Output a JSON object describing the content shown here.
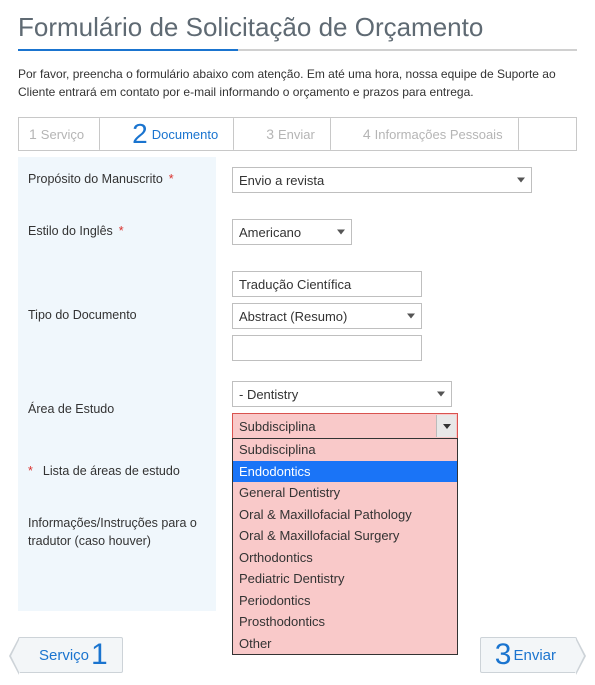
{
  "title": "Formulário de Solicitação de Orçamento",
  "intro": "Por favor, preencha o formulário abaixo com atenção. Em até uma hora, nossa equipe de Suporte ao Cliente entrará em contato por e-mail informando o orçamento e prazos para entrega.",
  "steps": [
    {
      "num": "1",
      "label": "Serviço"
    },
    {
      "num": "2",
      "label": "Documento"
    },
    {
      "num": "3",
      "label": "Enviar"
    },
    {
      "num": "4",
      "label": "Informações Pessoais"
    }
  ],
  "activeStep": 1,
  "fields": {
    "purpose": {
      "label": "Propósito do Manuscrito",
      "required": true,
      "value": "Envio a revista"
    },
    "english": {
      "label": "Estilo do Inglês",
      "required": true,
      "value": "Americano"
    },
    "doctype": {
      "label": "Tipo do Documento",
      "text1": "Tradução Científica",
      "select": "Abstract (Resumo)",
      "text2": ""
    },
    "area": {
      "label": "Área de Estudo",
      "required": true,
      "parent": "- Dentistry",
      "subPlaceholder": "Subdisciplina",
      "options": [
        "Subdisciplina",
        "Endodontics",
        "General Dentistry",
        "Oral & Maxillofacial Pathology",
        "Oral & Maxillofacial Surgery",
        "Orthodontics",
        "Pediatric Dentistry",
        "Periodontics",
        "Prosthodontics",
        "Other"
      ],
      "highlighted": "Endodontics"
    },
    "list": {
      "label": "Lista de áreas de estudo"
    },
    "instr": {
      "label": "Informações/Instruções para o tradutor (caso houver)"
    }
  },
  "nav": {
    "prev": {
      "num": "1",
      "label": "Serviço"
    },
    "next": {
      "num": "3",
      "label": "Enviar"
    }
  },
  "requiredMark": "*"
}
